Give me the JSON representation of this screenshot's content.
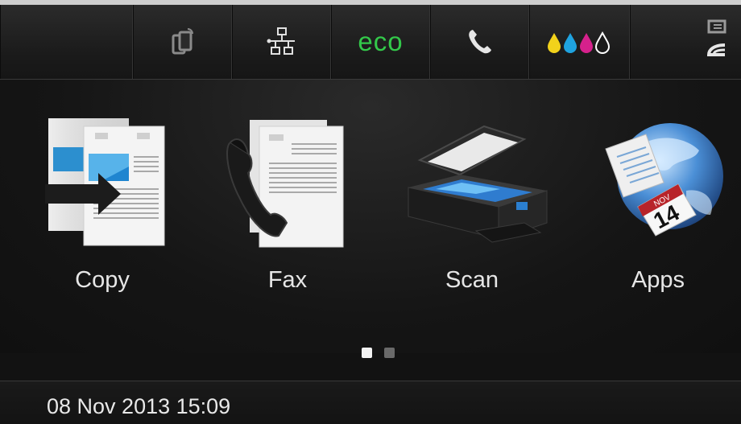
{
  "status_bar": {
    "eco_label": "eco",
    "icons": [
      "wireless-direct-icon",
      "network-icon",
      "eco-icon",
      "phone-icon",
      "ink-levels-icon",
      "paper-tray-icon"
    ],
    "ink_colors": [
      "#f2d21b",
      "#1fa3e0",
      "#d6218c",
      "#ffffff"
    ]
  },
  "apps": [
    {
      "label": "Copy",
      "icon": "copy-icon"
    },
    {
      "label": "Fax",
      "icon": "fax-icon"
    },
    {
      "label": "Scan",
      "icon": "scan-icon"
    },
    {
      "label": "Apps",
      "icon": "apps-icon"
    }
  ],
  "pager": {
    "pages": 2,
    "current": 1
  },
  "footer": {
    "datetime": "08 Nov 2013 15:09"
  },
  "apps_icon_calendar": {
    "month": "NOV",
    "day": "14"
  }
}
